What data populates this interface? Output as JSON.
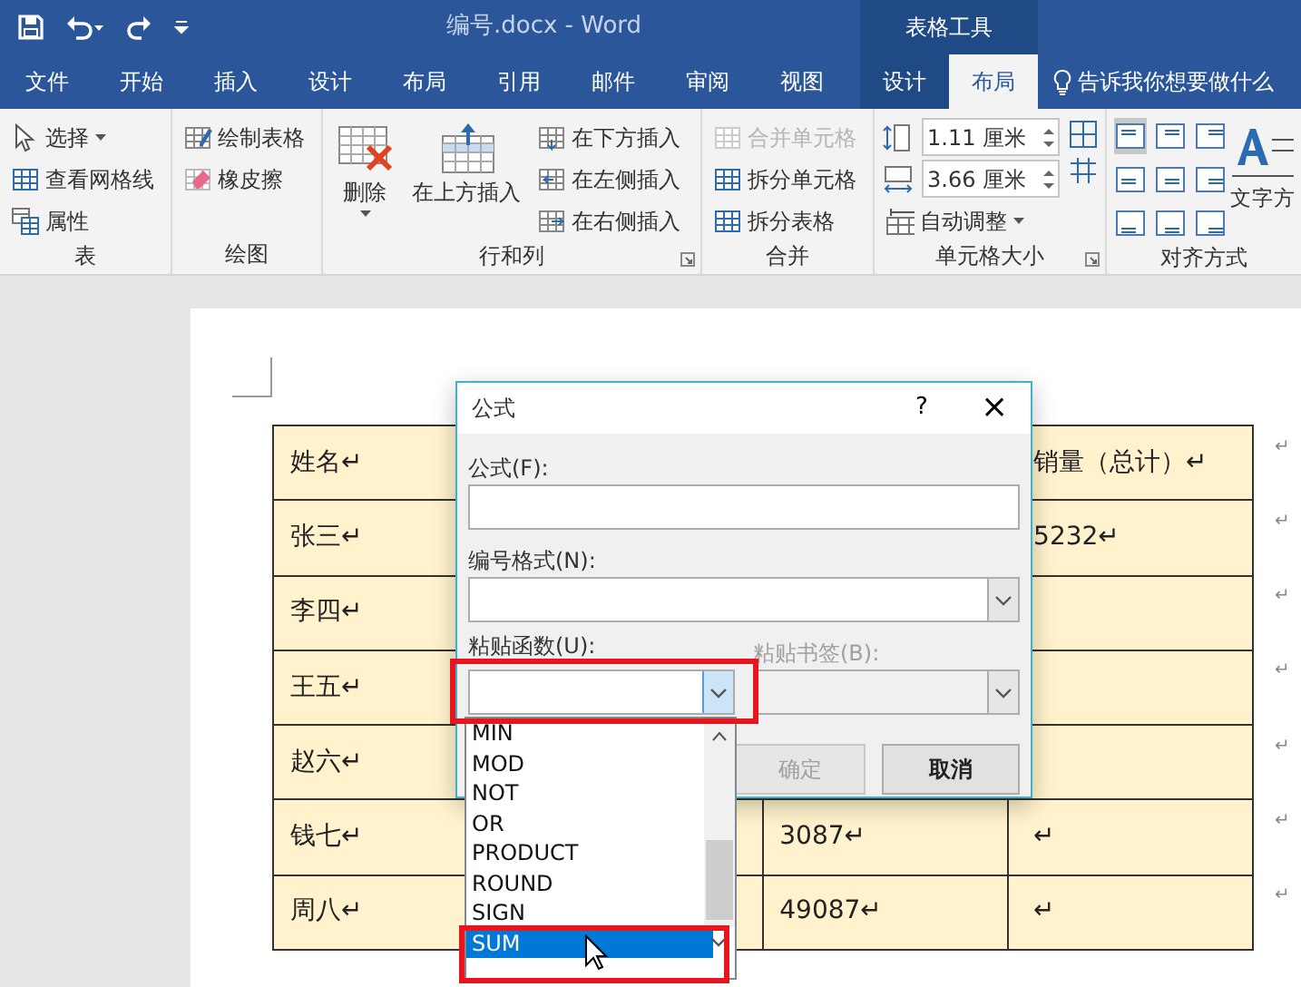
{
  "title_bar": {
    "title": "编号.docx  -  Word",
    "context_title": "表格工具"
  },
  "tabs": [
    {
      "label": "文件",
      "selected": false,
      "kind": "normal"
    },
    {
      "label": "开始",
      "selected": false,
      "kind": "normal"
    },
    {
      "label": "插入",
      "selected": false,
      "kind": "normal"
    },
    {
      "label": "设计",
      "selected": false,
      "kind": "normal"
    },
    {
      "label": "布局",
      "selected": false,
      "kind": "normal"
    },
    {
      "label": "引用",
      "selected": false,
      "kind": "normal"
    },
    {
      "label": "邮件",
      "selected": false,
      "kind": "normal"
    },
    {
      "label": "审阅",
      "selected": false,
      "kind": "normal"
    },
    {
      "label": "视图",
      "selected": false,
      "kind": "normal"
    },
    {
      "label": "设计",
      "selected": false,
      "kind": "context"
    },
    {
      "label": "布局",
      "selected": true,
      "kind": "context"
    }
  ],
  "tell_me": {
    "label": "告诉我你想要做什么"
  },
  "ribbon": {
    "groups": [
      {
        "name": "表",
        "launcher": false,
        "items": [
          {
            "kind": "small",
            "label": "选择",
            "dropdown": true,
            "disabled": false
          },
          {
            "kind": "small",
            "label": "查看网格线",
            "dropdown": false,
            "disabled": false
          },
          {
            "kind": "small",
            "label": "属性",
            "dropdown": false,
            "disabled": false
          }
        ]
      },
      {
        "name": "绘图",
        "launcher": false,
        "items": [
          {
            "kind": "small",
            "label": "绘制表格",
            "dropdown": false,
            "disabled": false
          },
          {
            "kind": "small",
            "label": "橡皮擦",
            "dropdown": false,
            "disabled": false
          }
        ]
      },
      {
        "name": "行和列",
        "launcher": true,
        "items": [
          {
            "kind": "large",
            "label": "删除",
            "dropdown": true,
            "disabled": false
          },
          {
            "kind": "large",
            "label": "在上方插入",
            "dropdown": false,
            "disabled": false
          },
          {
            "kind": "small",
            "label": "在下方插入",
            "dropdown": false,
            "disabled": false
          },
          {
            "kind": "small",
            "label": "在左侧插入",
            "dropdown": false,
            "disabled": false
          },
          {
            "kind": "small",
            "label": "在右侧插入",
            "dropdown": false,
            "disabled": false
          }
        ]
      },
      {
        "name": "合并",
        "launcher": false,
        "items": [
          {
            "kind": "small",
            "label": "合并单元格",
            "dropdown": false,
            "disabled": true
          },
          {
            "kind": "small",
            "label": "拆分单元格",
            "dropdown": false,
            "disabled": false
          },
          {
            "kind": "small",
            "label": "拆分表格",
            "dropdown": false,
            "disabled": false
          }
        ]
      },
      {
        "name": "单元格大小",
        "launcher": true,
        "items": [
          {
            "kind": "spin",
            "value": "1.11 厘米"
          },
          {
            "kind": "spin",
            "value": "3.66 厘米"
          },
          {
            "kind": "small",
            "label": "自动调整",
            "dropdown": true,
            "disabled": false
          }
        ]
      },
      {
        "name": "对齐方式",
        "launcher": false,
        "items": [
          {
            "kind": "align",
            "selected": true
          },
          {
            "kind": "align",
            "selected": false
          },
          {
            "kind": "align",
            "selected": false
          },
          {
            "kind": "align",
            "selected": false
          },
          {
            "kind": "align",
            "selected": false
          },
          {
            "kind": "align",
            "selected": false
          },
          {
            "kind": "align",
            "selected": false
          },
          {
            "kind": "align",
            "selected": false
          },
          {
            "kind": "align",
            "selected": false
          },
          {
            "kind": "large",
            "label": "文字方",
            "dropdown": false,
            "disabled": false
          }
        ]
      }
    ]
  },
  "table": {
    "rows": [
      {
        "cells": [
          "姓名↵",
          "",
          "",
          "销量（总计）↵"
        ],
        "end_mark": "↵"
      },
      {
        "cells": [
          "张三↵",
          "",
          "",
          "5232↵"
        ],
        "end_mark": "↵"
      },
      {
        "cells": [
          "李四↵",
          "",
          "",
          ""
        ],
        "end_mark": "↵"
      },
      {
        "cells": [
          "王五↵",
          "",
          "",
          ""
        ],
        "end_mark": "↵"
      },
      {
        "cells": [
          "赵六↵",
          "",
          "",
          ""
        ],
        "end_mark": "↵"
      },
      {
        "cells": [
          "钱七↵",
          "",
          "3087↵",
          "↵"
        ],
        "end_mark": "↵"
      },
      {
        "cells": [
          "周八↵",
          "",
          "49087↵",
          "↵"
        ],
        "end_mark": "↵"
      }
    ]
  },
  "dialog": {
    "title": "公式",
    "help": "?",
    "close": "×",
    "formula_label": "公式(F):",
    "number_format_label": "编号格式(N):",
    "paste_function": {
      "label": "粘贴函数(U):",
      "expanded": true
    },
    "paste_bookmark": {
      "label": "粘贴书签(B):",
      "disabled": true
    },
    "buttons": [
      {
        "label": "确定",
        "disabled": true
      },
      {
        "label": "取消",
        "disabled": false
      }
    ],
    "function_list": [
      {
        "label": "MIN",
        "selected": false
      },
      {
        "label": "MOD",
        "selected": false
      },
      {
        "label": "NOT",
        "selected": false
      },
      {
        "label": "OR",
        "selected": false
      },
      {
        "label": "PRODUCT",
        "selected": false
      },
      {
        "label": "ROUND",
        "selected": false
      },
      {
        "label": "SIGN",
        "selected": false
      },
      {
        "label": "SUM",
        "selected": true
      }
    ]
  }
}
